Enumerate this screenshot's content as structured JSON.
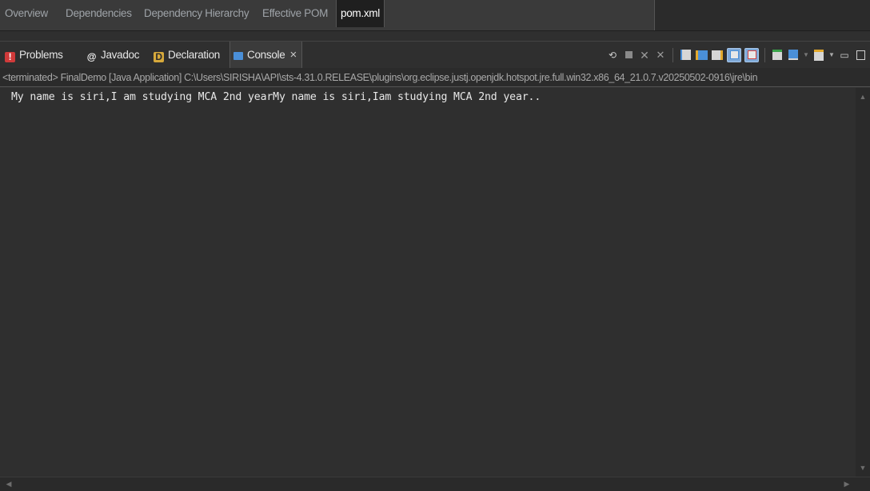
{
  "editor_tabs": [
    {
      "label": "Overview"
    },
    {
      "label": "Dependencies"
    },
    {
      "label": "Dependency Hierarchy"
    },
    {
      "label": "Effective POM"
    },
    {
      "label": "pom.xml",
      "active": true
    }
  ],
  "view_tabs": {
    "problems": "Problems",
    "javadoc": "Javadoc",
    "declaration": "Declaration",
    "console": "Console",
    "close": "×"
  },
  "toolbar_icons": [
    "terminate-relaunch-icon",
    "stop-icon",
    "remove-launch-icon",
    "remove-all-terminated-icon",
    "clear-console-icon",
    "scroll-lock-icon",
    "word-wrap-icon",
    "show-on-stdout-icon",
    "show-on-stderr-icon",
    "pin-console-icon",
    "display-console-icon",
    "open-console-icon",
    "minimize-icon",
    "maximize-icon"
  ],
  "status": {
    "text": "<terminated> FinalDemo [Java Application] C:\\Users\\SIRISHA\\API\\sts-4.31.0.RELEASE\\plugins\\org.eclipse.justj.openjdk.hotspot.jre.full.win32.x86_64_21.0.7.v20250502-0916\\jre\\bin"
  },
  "console": {
    "output": "My name is siri,I am studying MCA 2nd yearMy name is siri,Iam studying MCA 2nd year.."
  },
  "colors": {
    "background": "#2f2f2f",
    "active_tab": "#1f1f1f",
    "accent": "#4a8fd8"
  }
}
